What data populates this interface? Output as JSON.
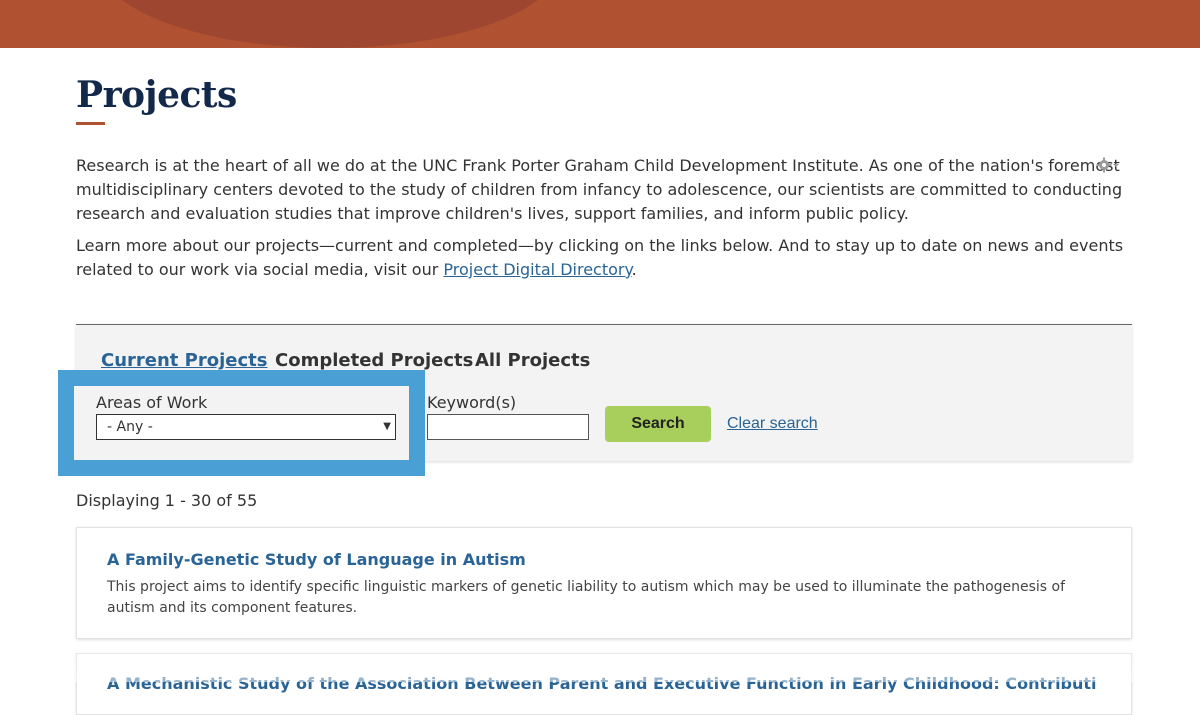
{
  "header": {
    "title": "Projects"
  },
  "intro": {
    "paragraph1": "Research is at the heart of all we do at the UNC Frank Porter Graham Child Development Institute. As one of the nation's foremost multidisciplinary centers devoted to the study of children from infancy to adolescence, our scientists are committed to conducting research and evaluation studies that improve children's lives, support families, and inform public policy.",
    "paragraph2_before": "Learn more about our projects—current and completed—by clicking on the links below. And to stay up to date on news and events related to our work via social media, visit our ",
    "paragraph2_link": "Project Digital Directory",
    "paragraph2_after": "."
  },
  "settings": {
    "icon": "gear-icon"
  },
  "tabs": {
    "current": "Current Projects",
    "completed": "Completed Projects",
    "all": "All Projects"
  },
  "filters": {
    "areas_label": "Areas of Work",
    "areas_selected": "- Any -",
    "keyword_label": "Keyword(s)",
    "keyword_value": "",
    "search_button": "Search",
    "clear_link": "Clear search"
  },
  "results": {
    "summary": "Displaying 1 - 30 of 55",
    "items": [
      {
        "title": "A Family-Genetic Study of Language in Autism",
        "description": "This project aims to identify specific linguistic markers of genetic liability to autism which may be used to illuminate the pathogenesis of autism and its component features."
      },
      {
        "title": "A Mechanistic Study of the Association Between Parent and Executive Function in Early Childhood: Contributions of Early",
        "description": ""
      }
    ]
  },
  "colors": {
    "banner": "#b05232",
    "title": "#13294b",
    "link": "#2a6496",
    "search_button": "#a8cf5c",
    "highlight": "#4a9fd4"
  }
}
